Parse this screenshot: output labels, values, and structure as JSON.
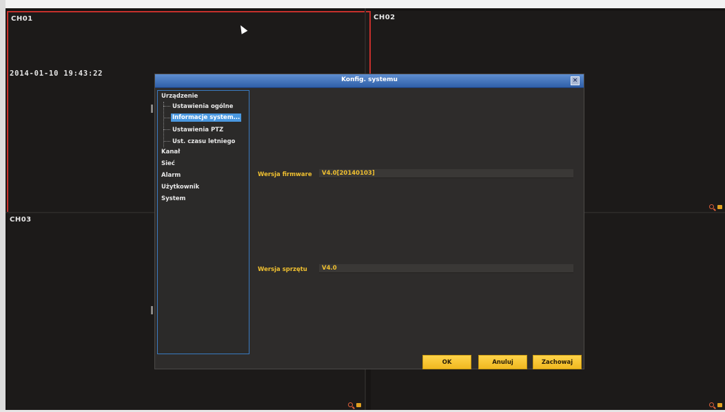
{
  "cameras": [
    {
      "id": "ch01",
      "label": "CH01",
      "timestamp": "2014-01-10  19:43:22",
      "selected": true
    },
    {
      "id": "ch02",
      "label": "CH02"
    },
    {
      "id": "ch03",
      "label": "CH03"
    },
    {
      "id": "ch04",
      "label": ""
    }
  ],
  "icons": {
    "zoom": "zoom-icon",
    "record": "record-icon",
    "cursor": "mouse-pointer",
    "close": "close-icon"
  },
  "colors": {
    "accent": "#4a98e0",
    "highlight_text": "#f0c030",
    "button": "#ffd44a",
    "selected_border": "#c8302c"
  },
  "dialog": {
    "title": "Konfig. systemu",
    "close_label": "×",
    "tree": [
      {
        "label": "Urządzenie",
        "level": 0
      },
      {
        "label": "Ustawienia ogólne",
        "level": 1
      },
      {
        "label": "Informacje system...",
        "level": 1,
        "active": true
      },
      {
        "label": "Ustawienia PTZ",
        "level": 1
      },
      {
        "label": "Ust. czasu letniego",
        "level": 1
      },
      {
        "label": "Kanał",
        "level": 0
      },
      {
        "label": "Sieć",
        "level": 0
      },
      {
        "label": "Alarm",
        "level": 0
      },
      {
        "label": "Użytkownik",
        "level": 0
      },
      {
        "label": "System",
        "level": 0
      }
    ],
    "fields": {
      "firmware": {
        "label": "Wersja firmware",
        "value": "V4.0[20140103]"
      },
      "hardware": {
        "label": "Wersja sprzętu",
        "value": "V4.0"
      }
    },
    "buttons": {
      "ok": "OK",
      "cancel": "Anuluj",
      "save": "Zachowaj"
    }
  }
}
